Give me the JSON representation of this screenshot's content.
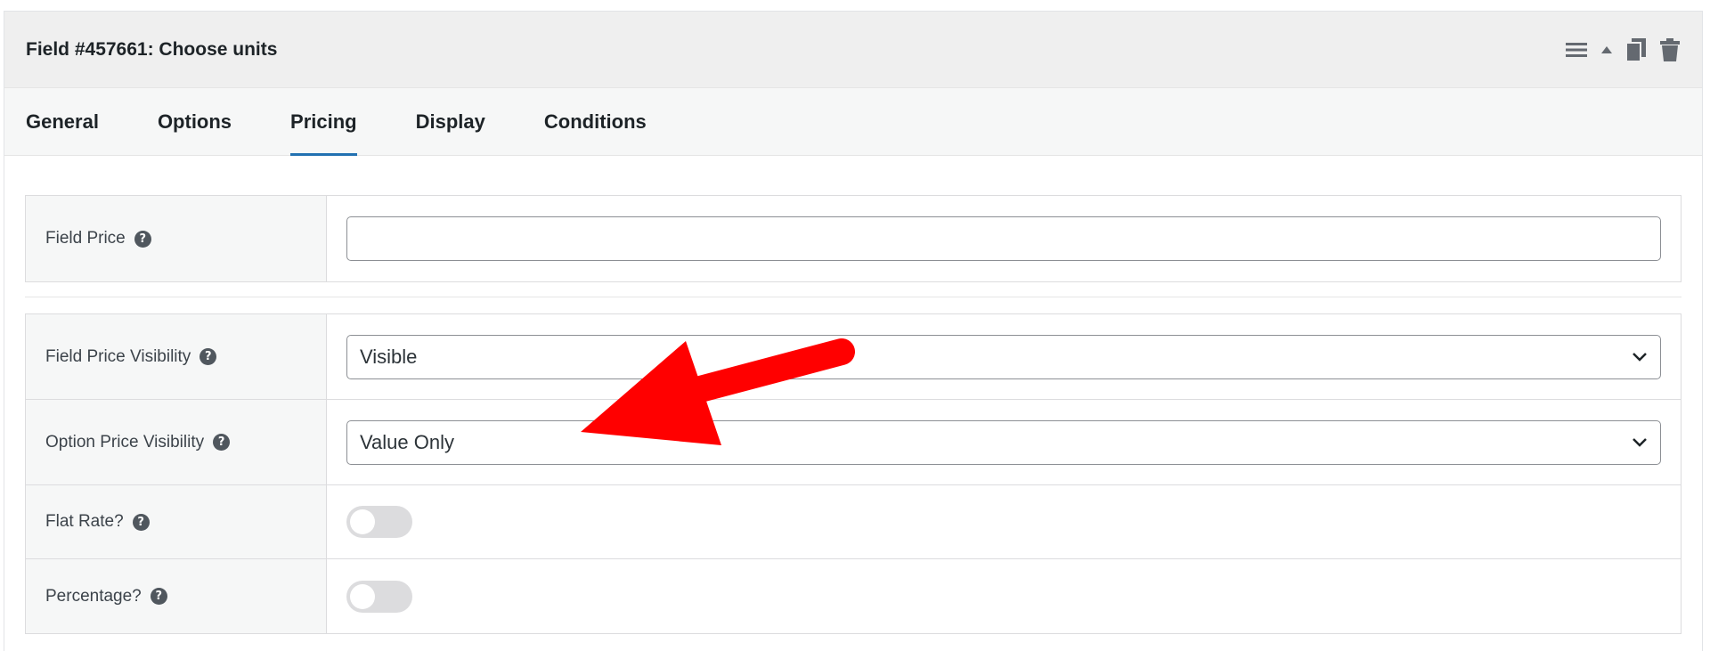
{
  "header": {
    "title": "Field #457661: Choose units",
    "icons": [
      "menu-icon",
      "collapse-up-icon",
      "duplicate-icon",
      "trash-icon"
    ]
  },
  "tabs": [
    {
      "label": "General",
      "active": false
    },
    {
      "label": "Options",
      "active": false
    },
    {
      "label": "Pricing",
      "active": true
    },
    {
      "label": "Display",
      "active": false
    },
    {
      "label": "Conditions",
      "active": false
    }
  ],
  "fields": {
    "field_price": {
      "label": "Field Price",
      "value": "",
      "help": "?"
    },
    "field_price_visibility": {
      "label": "Field Price Visibility",
      "selected": "Visible",
      "help": "?"
    },
    "option_price_visibility": {
      "label": "Option Price Visibility",
      "selected": "Value Only",
      "help": "?"
    },
    "flat_rate": {
      "label": "Flat Rate?",
      "checked": false,
      "help": "?"
    },
    "percentage": {
      "label": "Percentage?",
      "checked": false,
      "help": "?"
    }
  },
  "annotation": {
    "arrow_color": "#ff0000"
  },
  "colors": {
    "accent": "#2271b1",
    "header_bg": "#efefef",
    "tabs_bg": "#f6f7f7"
  }
}
